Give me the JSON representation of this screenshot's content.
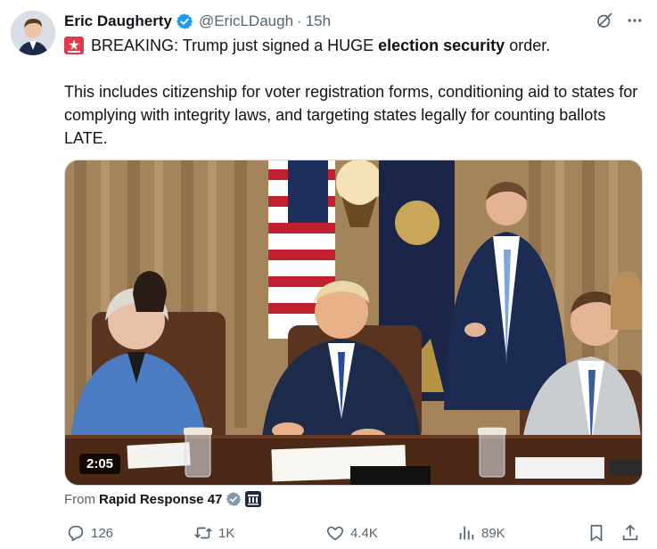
{
  "author": {
    "display_name": "Eric Daugherty",
    "handle": "@EricLDaugh",
    "separator": "·",
    "time": "15h"
  },
  "post": {
    "line1_prefix": "BREAKING: Trump just signed a HUGE ",
    "line1_bold": "election security",
    "line1_suffix": " order.",
    "paragraph2": "This includes citizenship for voter registration forms, conditioning aid to states for complying with integrity laws, and targeting states legally for counting ballots LATE."
  },
  "media": {
    "duration": "2:05"
  },
  "source": {
    "prefix": "From",
    "name": "Rapid Response 47"
  },
  "actions": {
    "replies": "126",
    "reposts": "1K",
    "likes": "4.4K",
    "views": "89K"
  },
  "icons": {
    "verified": "verified-badge-icon",
    "siren": "rotating-light-emoji",
    "grok": "grok-icon",
    "more": "more-icon",
    "reply": "reply-icon",
    "repost": "repost-icon",
    "like": "heart-icon",
    "views": "views-icon",
    "bookmark": "bookmark-icon",
    "share": "share-icon"
  },
  "colors": {
    "verified_blue": "#1d9bf0",
    "secondary_text": "#536471"
  }
}
